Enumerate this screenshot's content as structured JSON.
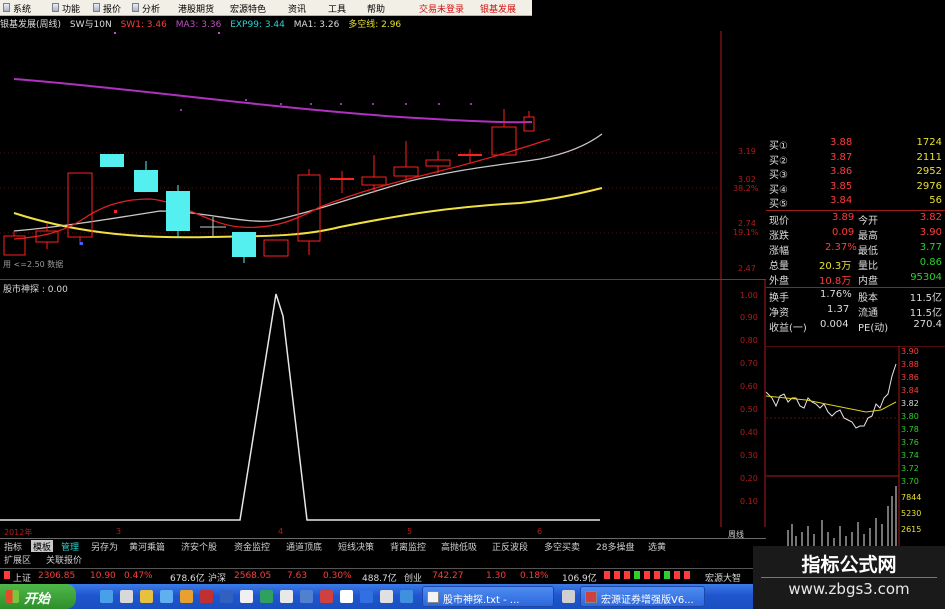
{
  "menubar": {
    "items": [
      "系统",
      "功能",
      "报价",
      "分析",
      "港股期货",
      "宏源特色",
      "资讯",
      "工具",
      "帮助"
    ],
    "login_status": "交易未登录",
    "stock_name": "银基发展"
  },
  "kline": {
    "status": {
      "title": "银基发展(周线)",
      "formula": "SW与10N",
      "sw1": "SW1: 3.46",
      "ma3": "MA3: 3.36",
      "exp99": "EXP99: 3.44",
      "ma1": "MA1: 3.26",
      "bull_bear": "多空线: 2.96"
    },
    "price_labels": [
      "3.19",
      "3.02",
      "38.2%",
      "2.74",
      "19.1%",
      "2.47"
    ],
    "volume_note": "用 <=2.50 数据",
    "colors": {
      "up": "#ff2020",
      "down": "#54f0f0",
      "ma_purple": "#b030c0",
      "ma_yellow": "#f0e040",
      "ma_white": "#c8c8c8"
    }
  },
  "indicator": {
    "status": "股市神探 : 0.00",
    "labels": [
      "1.00",
      "0.90",
      "0.80",
      "0.70",
      "0.60",
      "0.50",
      "0.40",
      "0.30",
      "0.20",
      "0.10"
    ]
  },
  "dates": [
    "2012年",
    "3",
    "4",
    "5",
    "6"
  ],
  "quote": {
    "bids": [
      {
        "label": "买①",
        "price": "3.88",
        "vol": "1724"
      },
      {
        "label": "买②",
        "price": "3.87",
        "vol": "2111"
      },
      {
        "label": "买③",
        "price": "3.86",
        "vol": "2952"
      },
      {
        "label": "买④",
        "price": "3.85",
        "vol": "2976"
      },
      {
        "label": "买⑤",
        "price": "3.84",
        "vol": "56"
      }
    ],
    "stats": [
      {
        "l1": "现价",
        "v1": "3.89",
        "c1": "r",
        "l2": "今开",
        "v2": "3.82",
        "c2": "r"
      },
      {
        "l1": "涨跌",
        "v1": "0.09",
        "c1": "r",
        "l2": "最高",
        "v2": "3.90",
        "c2": "r"
      },
      {
        "l1": "涨幅",
        "v1": "2.37%",
        "c1": "r",
        "l2": "最低",
        "v2": "3.77",
        "c2": "g"
      },
      {
        "l1": "总量",
        "v1": "20.3万",
        "c1": "y",
        "l2": "量比",
        "v2": "0.86",
        "c2": "g"
      },
      {
        "l1": "外盘",
        "v1": "10.8万",
        "c1": "r",
        "l2": "内盘",
        "v2": "95304",
        "c2": "g"
      }
    ],
    "stats2": [
      {
        "l1": "换手",
        "v1": "1.76%",
        "l2": "股本",
        "v2": "11.5亿"
      },
      {
        "l1": "净资",
        "v1": "1.37",
        "l2": "流通",
        "v2": "11.5亿"
      },
      {
        "l1": "收益(一)",
        "v1": "0.004",
        "l2": "PE(动)",
        "v2": "270.4"
      }
    ]
  },
  "mini": {
    "price_labels": [
      "3.90",
      "3.88",
      "3.86",
      "3.84",
      "3.82",
      "3.80",
      "3.78",
      "3.76",
      "3.74",
      "3.72",
      "3.70"
    ],
    "vol_labels": [
      "7844",
      "5230",
      "2615"
    ]
  },
  "tabs": {
    "row1": [
      "指标",
      "模板",
      "管理",
      "另存为",
      "黄河乘篇",
      "济安个股",
      "资金监控",
      "通道顶底",
      "短线决策",
      "背离监控",
      "高抛低吸",
      "正反波段",
      "多空买卖",
      "28多操盘",
      "选黄"
    ],
    "row2": [
      "扩展区",
      "关联报价"
    ],
    "week": "周线"
  },
  "ticker": [
    {
      "name": "上证",
      "val": "2306.85",
      "chg": "10.90",
      "pct": "0.47%",
      "amt": "678.6亿"
    },
    {
      "name": "沪深",
      "val": "2568.05",
      "chg": "7.63",
      "pct": "0.30%",
      "amt": "488.7亿"
    },
    {
      "name": "创业",
      "val": "742.27",
      "chg": "1.30",
      "pct": "0.18%",
      "amt": "106.9亿"
    }
  ],
  "ticker_tail": "宏源大智",
  "taskbar": {
    "start": "开始",
    "task1": "股市神探.txt - ...",
    "task2": "宏源证券增强版V6..."
  },
  "watermark": {
    "title": "指标公式网",
    "url": "www.zbgs3.com"
  }
}
